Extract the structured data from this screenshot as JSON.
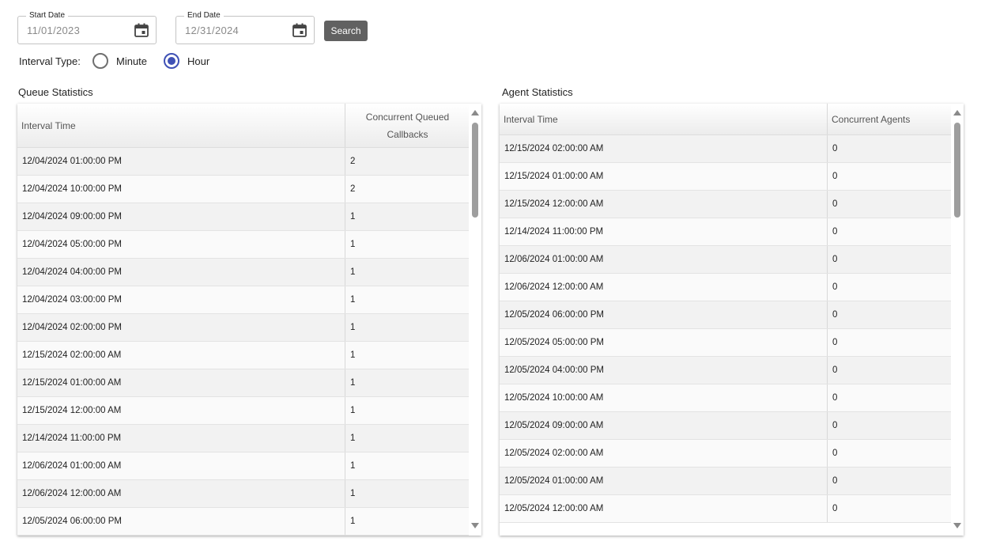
{
  "filters": {
    "start_date_label": "Start Date",
    "start_date_value": "11/01/2023",
    "end_date_label": "End Date",
    "end_date_value": "12/31/2024",
    "search_label": "Search",
    "interval_type_label": "Interval Type:",
    "interval_options": [
      {
        "label": "Minute",
        "selected": false
      },
      {
        "label": "Hour",
        "selected": true
      }
    ]
  },
  "queue": {
    "title": "Queue Statistics",
    "col1": "Interval Time",
    "col2": "Concurrent Queued Callbacks",
    "rows": [
      {
        "time": "12/04/2024 01:00:00 PM",
        "value": "2"
      },
      {
        "time": "12/04/2024 10:00:00 PM",
        "value": "2"
      },
      {
        "time": "12/04/2024 09:00:00 PM",
        "value": "1"
      },
      {
        "time": "12/04/2024 05:00:00 PM",
        "value": "1"
      },
      {
        "time": "12/04/2024 04:00:00 PM",
        "value": "1"
      },
      {
        "time": "12/04/2024 03:00:00 PM",
        "value": "1"
      },
      {
        "time": "12/04/2024 02:00:00 PM",
        "value": "1"
      },
      {
        "time": "12/15/2024 02:00:00 AM",
        "value": "1"
      },
      {
        "time": "12/15/2024 01:00:00 AM",
        "value": "1"
      },
      {
        "time": "12/15/2024 12:00:00 AM",
        "value": "1"
      },
      {
        "time": "12/14/2024 11:00:00 PM",
        "value": "1"
      },
      {
        "time": "12/06/2024 01:00:00 AM",
        "value": "1"
      },
      {
        "time": "12/06/2024 12:00:00 AM",
        "value": "1"
      },
      {
        "time": "12/05/2024 06:00:00 PM",
        "value": "1"
      }
    ]
  },
  "agent": {
    "title": "Agent Statistics",
    "col1": "Interval Time",
    "col2": "Concurrent Agents",
    "rows": [
      {
        "time": "12/15/2024 02:00:00 AM",
        "value": "0"
      },
      {
        "time": "12/15/2024 01:00:00 AM",
        "value": "0"
      },
      {
        "time": "12/15/2024 12:00:00 AM",
        "value": "0"
      },
      {
        "time": "12/14/2024 11:00:00 PM",
        "value": "0"
      },
      {
        "time": "12/06/2024 01:00:00 AM",
        "value": "0"
      },
      {
        "time": "12/06/2024 12:00:00 AM",
        "value": "0"
      },
      {
        "time": "12/05/2024 06:00:00 PM",
        "value": "0"
      },
      {
        "time": "12/05/2024 05:00:00 PM",
        "value": "0"
      },
      {
        "time": "12/05/2024 04:00:00 PM",
        "value": "0"
      },
      {
        "time": "12/05/2024 10:00:00 AM",
        "value": "0"
      },
      {
        "time": "12/05/2024 09:00:00 AM",
        "value": "0"
      },
      {
        "time": "12/05/2024 02:00:00 AM",
        "value": "0"
      },
      {
        "time": "12/05/2024 01:00:00 AM",
        "value": "0"
      },
      {
        "time": "12/05/2024 12:00:00 AM",
        "value": "0"
      }
    ]
  },
  "icons": {
    "calendar": "calendar-icon",
    "scroll_up": "scroll-up-arrow-icon",
    "scroll_down": "scroll-down-arrow-icon"
  },
  "colors": {
    "accent": "#3f51b5",
    "button": "#616161"
  }
}
